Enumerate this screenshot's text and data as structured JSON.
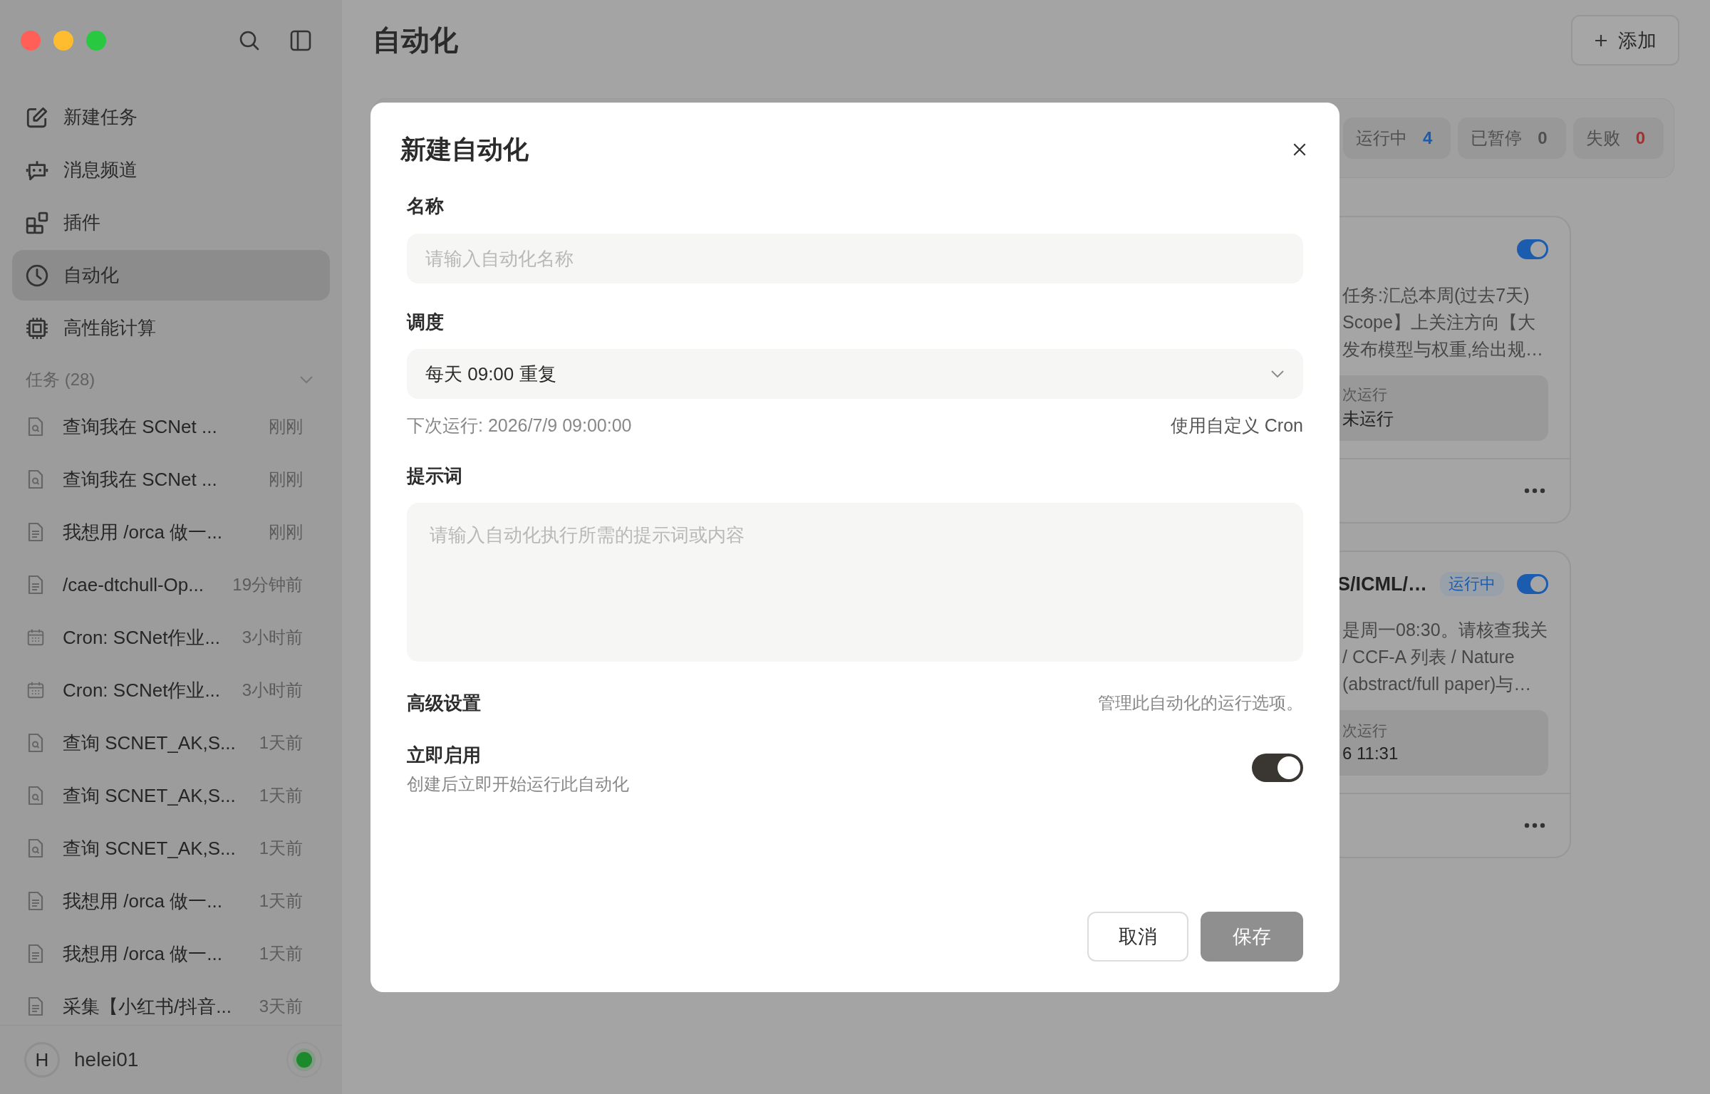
{
  "sidebar": {
    "nav": [
      {
        "label": "新建任务",
        "kind": "edit",
        "selected": false
      },
      {
        "label": "消息频道",
        "kind": "bot",
        "selected": false
      },
      {
        "label": "插件",
        "kind": "plugin",
        "selected": false
      },
      {
        "label": "自动化",
        "kind": "clock",
        "selected": true
      },
      {
        "label": "高性能计算",
        "kind": "chip",
        "selected": false
      }
    ],
    "tasks_header": "任务 (28)",
    "tasks": [
      {
        "title": "查询我在 SCNet ...",
        "time": "刚刚",
        "kind": "search"
      },
      {
        "title": "查询我在 SCNet ...",
        "time": "刚刚",
        "kind": "search"
      },
      {
        "title": "我想用 /orca 做一...",
        "time": "刚刚",
        "kind": "doc"
      },
      {
        "title": "/cae-dtchull-Op...",
        "time": "19分钟前",
        "kind": "doc"
      },
      {
        "title": "Cron: SCNet作业...",
        "time": "3小时前",
        "kind": "calendar"
      },
      {
        "title": "Cron: SCNet作业...",
        "time": "3小时前",
        "kind": "calendar"
      },
      {
        "title": "查询 SCNET_AK,S...",
        "time": "1天前",
        "kind": "search"
      },
      {
        "title": "查询 SCNET_AK,S...",
        "time": "1天前",
        "kind": "search"
      },
      {
        "title": "查询 SCNET_AK,S...",
        "time": "1天前",
        "kind": "search"
      },
      {
        "title": "我想用 /orca 做一...",
        "time": "1天前",
        "kind": "doc"
      },
      {
        "title": "我想用 /orca 做一...",
        "time": "1天前",
        "kind": "doc"
      },
      {
        "title": "采集【小红书/抖音...",
        "time": "3天前",
        "kind": "doc"
      }
    ],
    "user": {
      "initial": "H",
      "name": "helei01"
    }
  },
  "page": {
    "title": "自动化",
    "add_button": "添加",
    "stats": [
      {
        "label": "运行中",
        "count": "4",
        "color": "#1c5cae"
      },
      {
        "label": "已暂停",
        "count": "0",
        "color": "#505050"
      },
      {
        "label": "失败",
        "count": "0",
        "color": "#a82e2e"
      }
    ],
    "cards": [
      {
        "on": true,
        "lines": [
          "任务:汇总本周(过去7天)",
          "Scope】上关注方向【大",
          "发布模型与权重,给出规…"
        ],
        "run_label": "次运行",
        "run_value": "未运行"
      },
      {
        "title": "S/ICML/…",
        "badge": "运行中",
        "on": true,
        "lines": [
          "是周一08:30。请核查我关",
          "/ CCF-A 列表 / Nature",
          "(abstract/full paper)与…"
        ],
        "run_label": "次运行",
        "run_value": "6 11:31"
      }
    ]
  },
  "dialog": {
    "title": "新建自动化",
    "name_label": "名称",
    "name_placeholder": "请输入自动化名称",
    "schedule_label": "调度",
    "schedule_value": "每天 09:00 重复",
    "next_run": "下次运行: 2026/7/9 09:00:00",
    "custom_cron": "使用自定义 Cron",
    "prompt_label": "提示词",
    "prompt_placeholder": "请输入自动化执行所需的提示词或内容",
    "advanced_label": "高级设置",
    "advanced_hint": "管理此自动化的运行选项。",
    "enable_label": "立即启用",
    "enable_hint": "创建后立即开始运行此自动化",
    "enable_on": true,
    "cancel": "取消",
    "save": "保存",
    "save_disabled": true
  }
}
